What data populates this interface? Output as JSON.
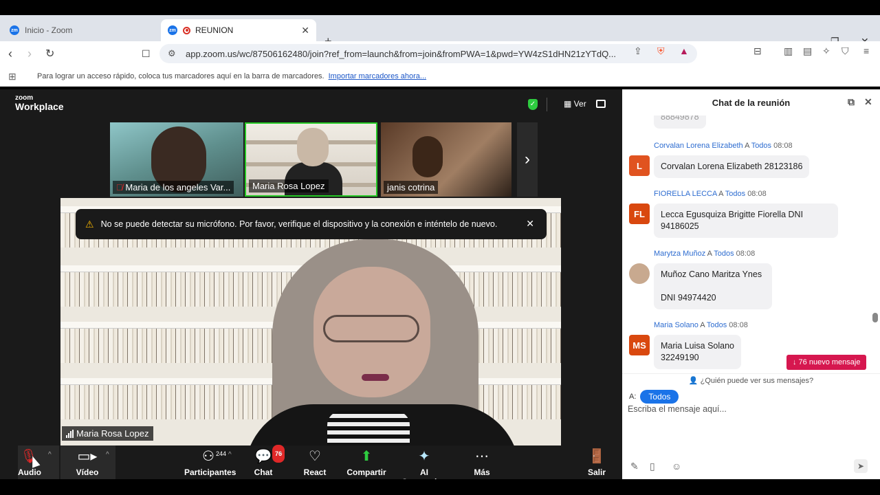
{
  "browser": {
    "tabs": [
      {
        "label": "Inicio - Zoom",
        "active": false
      },
      {
        "label": "REUNION",
        "active": true
      }
    ],
    "new_tab": "+",
    "window_controls": {
      "minimize": "–",
      "restore": "❐",
      "close": "✕"
    },
    "url": "app.zoom.us/wc/87506162480/join?ref_from=launch&from=join&fromPWA=1&pwd=YW4zS1dHN21zYTdQ...",
    "bookmarks_text": "Para lograr un acceso rápido, coloca tus marcadores aquí en la barra de marcadores.",
    "bookmarks_link": "Importar marcadores ahora..."
  },
  "meeting": {
    "logo_top": "zoom",
    "logo_bottom": "Workplace",
    "view_label": "Ver",
    "participants": [
      {
        "name": "Maria de los angeles Var...",
        "muted": true
      },
      {
        "name": "Maria Rosa Lopez",
        "muted": false
      },
      {
        "name": "janis cotrina",
        "muted": false
      }
    ],
    "warning": "No se puede detectar su micrófono. Por favor, verifique el dispositivo y la conexión e inténtelo de nuevo.",
    "main_speaker": "Maria Rosa Lopez",
    "toolbar": {
      "audio": "Audio",
      "video": "Vídeo",
      "participants": "Participantes",
      "participants_count": "244",
      "chat": "Chat",
      "chat_count": "76",
      "react": "React",
      "share": "Compartir",
      "ai": "AI Companion",
      "more": "Más",
      "leave": "Salir"
    }
  },
  "chat": {
    "title": "Chat de la reunión",
    "partial_top": "88849878",
    "messages": [
      {
        "sender": "Corvalan Lorena Elizabeth",
        "to": "A",
        "to_name": "Todos",
        "time": "08:08",
        "avatar": "L",
        "color": "#e05320",
        "lines": [
          "Corvalan Lorena Elizabeth 28123186"
        ]
      },
      {
        "sender": "FIORELLA LECCA",
        "to": "A",
        "to_name": "Todos",
        "time": "08:08",
        "avatar": "FL",
        "color": "#d9480f",
        "lines": [
          "Lecca Egusquiza Brigitte Fiorella DNI",
          "94186025"
        ]
      },
      {
        "sender": "Marytza Muñoz",
        "to": "A",
        "to_name": "Todos",
        "time": "08:08",
        "avatar": "",
        "color": "#c8a98f",
        "lines": [
          "Muñoz Cano Maritza Ynes",
          "",
          "DNI 94974420"
        ]
      },
      {
        "sender": "Maria Solano",
        "to": "A",
        "to_name": "Todos",
        "time": "08:08",
        "avatar": "MS",
        "color": "#d9480f",
        "lines": [
          "Maria Luisa Solano",
          "32249190"
        ]
      }
    ],
    "new_messages": "↓ 76 nuevo mensaje",
    "who_can_see": "¿Quién puede ver sus mensajes?",
    "to_label": "A:",
    "to_value": "Todos",
    "input_placeholder": "Escriba el mensaje aquí..."
  }
}
